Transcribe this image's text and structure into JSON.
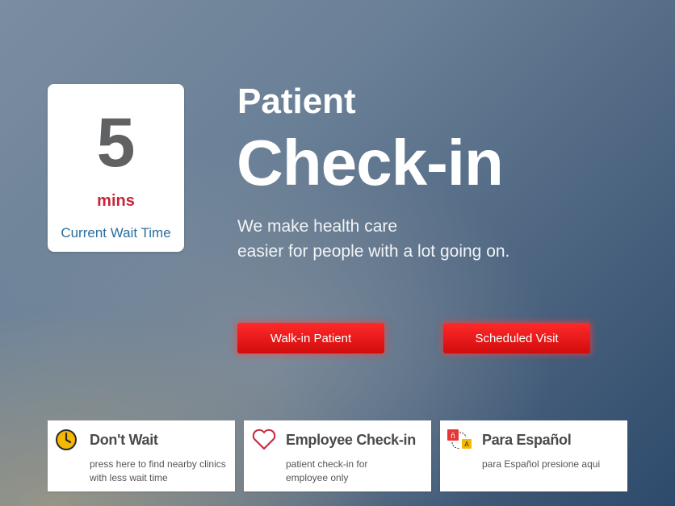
{
  "wait_card": {
    "number": "5",
    "unit": "mins",
    "label": "Current Wait Time"
  },
  "hero": {
    "title_small": "Patient",
    "title_big": "Check-in",
    "tagline_line1": "We make health care",
    "tagline_line2": "easier for people with a lot going on."
  },
  "buttons": {
    "walkin": "Walk-in Patient",
    "scheduled": "Scheduled Visit"
  },
  "tiles": [
    {
      "title": "Don't Wait",
      "desc_line1": "press here to find nearby clinics",
      "desc_line2": "with less wait time",
      "icon": "clock-icon"
    },
    {
      "title": "Employee Check-in",
      "desc_line1": "patient check-in for",
      "desc_line2": "employee only",
      "icon": "heart-icon"
    },
    {
      "title": "Para Español",
      "desc_line1": "para Español presione aqui",
      "desc_line2": "",
      "icon": "translate-icon"
    }
  ],
  "colors": {
    "accent_red": "#e01414",
    "wait_unit": "#c8253a",
    "wait_label": "#2a6d9e",
    "clock_yellow": "#f5b800"
  }
}
